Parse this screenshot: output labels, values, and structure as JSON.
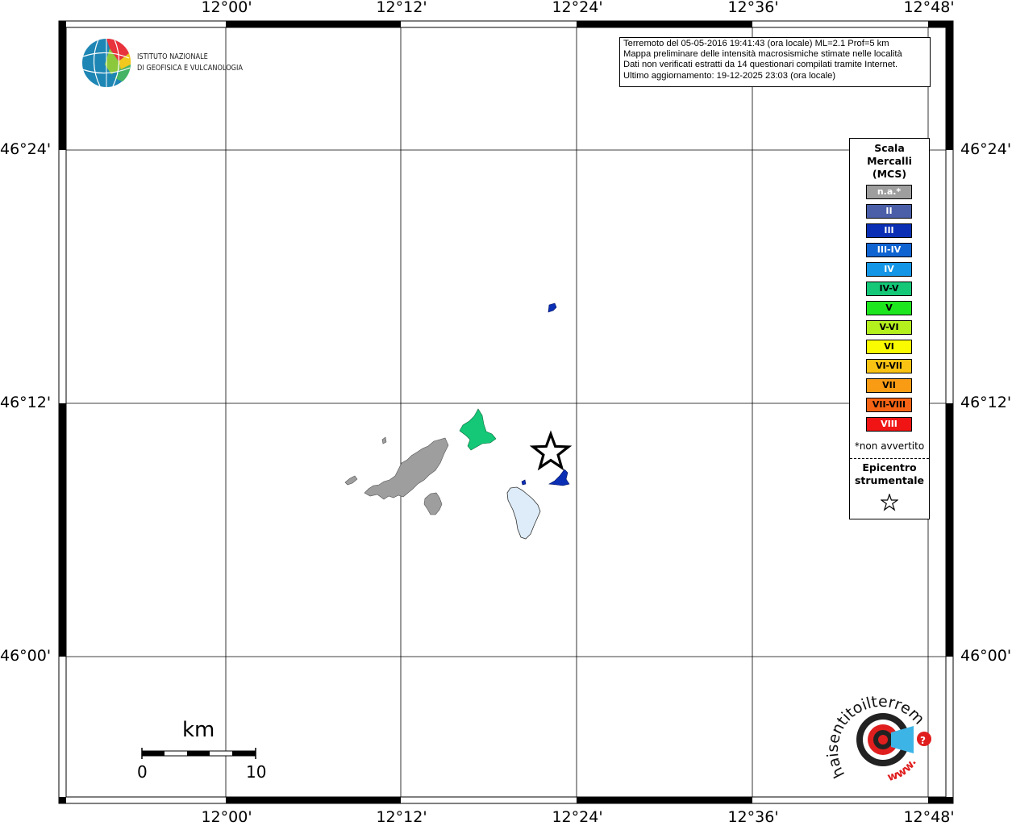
{
  "map": {
    "lon_labels": [
      "12°00'",
      "12°12'",
      "12°24'",
      "12°36'",
      "12°48'"
    ],
    "lat_labels": [
      "46°24'",
      "46°12'",
      "46°00'"
    ]
  },
  "logo": {
    "institute_line1": "ISTITUTO NAZIONALE",
    "institute_line2": "DI GEOFISICA E VULCANOLOGIA",
    "globe_icon": "ingv-globe-icon"
  },
  "info": {
    "line1": "Terremoto del 05-05-2016 19:41:43 (ora locale) ML=2.1 Prof=5 km",
    "line2": "Mappa preliminare delle intensità macrosismiche stimate nelle località",
    "line3": "Dati non verificati estratti da 14 questionari compilati tramite Internet.",
    "line4": "Ultimo aggiornamento: 19-12-2025 23:03 (ora locale)"
  },
  "legend": {
    "title1": "Scala",
    "title2": "Mercalli",
    "title3": "(MCS)",
    "items": [
      {
        "label": "n.a.*",
        "color": "#9e9e9e",
        "text": "#ffffff"
      },
      {
        "label": "II",
        "color": "#4a5fa8",
        "text": "#ffffff"
      },
      {
        "label": "III",
        "color": "#0a2fb4",
        "text": "#ffffff"
      },
      {
        "label": "III-IV",
        "color": "#0f64d2",
        "text": "#ffffff"
      },
      {
        "label": "IV",
        "color": "#1496e6",
        "text": "#ffffff"
      },
      {
        "label": "IV-V",
        "color": "#14c878",
        "text": "#000000"
      },
      {
        "label": "V",
        "color": "#1ee61e",
        "text": "#000000"
      },
      {
        "label": "V-VI",
        "color": "#b4f01e",
        "text": "#000000"
      },
      {
        "label": "VI",
        "color": "#fafa00",
        "text": "#000000"
      },
      {
        "label": "VI-VII",
        "color": "#fac314",
        "text": "#000000"
      },
      {
        "label": "VII",
        "color": "#fa9b14",
        "text": "#000000"
      },
      {
        "label": "VII-VIII",
        "color": "#f56414",
        "text": "#000000"
      },
      {
        "label": "VIII",
        "color": "#f01414",
        "text": "#ffffff"
      }
    ],
    "note": "*non avvertito",
    "epicenter1": "Epicentro",
    "epicenter2": "strumentale",
    "epicenter_icon": "star-outline-icon"
  },
  "scalebar": {
    "unit": "km",
    "min": "0",
    "max": "10"
  },
  "haisentito": {
    "text": "haisentitoilterremoto.it",
    "www": "www.",
    "icon": "haisentito-target-icon",
    "question_mark": "?"
  },
  "colors": {
    "na": "#9e9e9e",
    "iii": "#0a2fb4",
    "iv_v": "#14c878",
    "lake": "#ddecf8"
  }
}
